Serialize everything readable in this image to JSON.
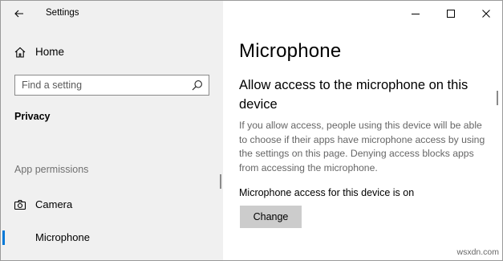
{
  "window": {
    "title": "Settings"
  },
  "sidebar": {
    "home_label": "Home",
    "search_placeholder": "Find a setting",
    "section_title": "Privacy",
    "group_label": "App permissions",
    "items": [
      {
        "label": "Camera",
        "icon": "camera-icon",
        "selected": false
      },
      {
        "label": "Microphone",
        "icon": "microphone-icon",
        "selected": true
      }
    ]
  },
  "main": {
    "page_title": "Microphone",
    "heading": "Allow access to the microphone on this device",
    "description": "If you allow access, people using this device will be able to choose if their apps have microphone access by using the settings on this page. Denying access blocks apps from accessing the microphone.",
    "status": "Microphone access for this device is on",
    "change_button": "Change"
  },
  "watermark": "wsxdn.com",
  "colors": {
    "accent": "#0078d7",
    "sidebar_bg": "#f0f0f0",
    "button_bg": "#cccccc"
  }
}
